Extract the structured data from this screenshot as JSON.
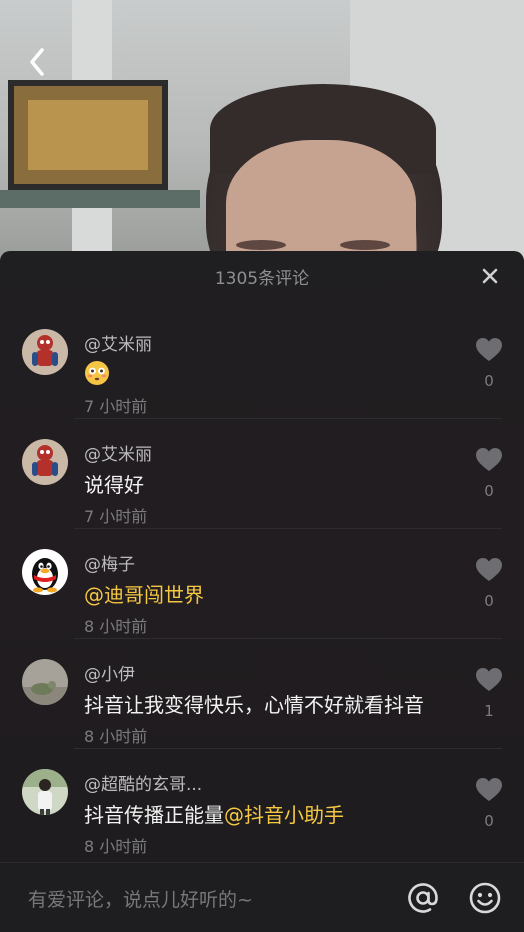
{
  "header": {
    "comment_count": "1305条评论"
  },
  "comments": [
    {
      "username": "@艾米丽",
      "text": "",
      "emoji": "😳",
      "mention": "",
      "time": "7 小时前",
      "likes": "0",
      "avatar": "spiderman-avatar-icon"
    },
    {
      "username": "@艾米丽",
      "text": "说得好",
      "emoji": "",
      "mention": "",
      "time": "7 小时前",
      "likes": "0",
      "avatar": "spiderman-avatar-icon"
    },
    {
      "username": "@梅子",
      "text": "",
      "emoji": "",
      "mention": "@迪哥闯世界",
      "time": "8 小时前",
      "likes": "0",
      "avatar": "qq-penguin-avatar-icon"
    },
    {
      "username": "@小伊",
      "text": "抖音让我变得快乐，心情不好就看抖音",
      "emoji": "",
      "mention": "",
      "time": "8 小时前",
      "likes": "1",
      "avatar": "photo-avatar"
    },
    {
      "username": "@超酷的玄哥...",
      "text": "抖音传播正能量",
      "emoji": "",
      "mention": "@抖音小助手",
      "time": "8 小时前",
      "likes": "0",
      "avatar": "photo-avatar"
    }
  ],
  "input": {
    "placeholder": "有爱评论，说点儿好听的~"
  },
  "colors": {
    "mention": "#f5c842",
    "panel_bg": "#1f1e20"
  }
}
